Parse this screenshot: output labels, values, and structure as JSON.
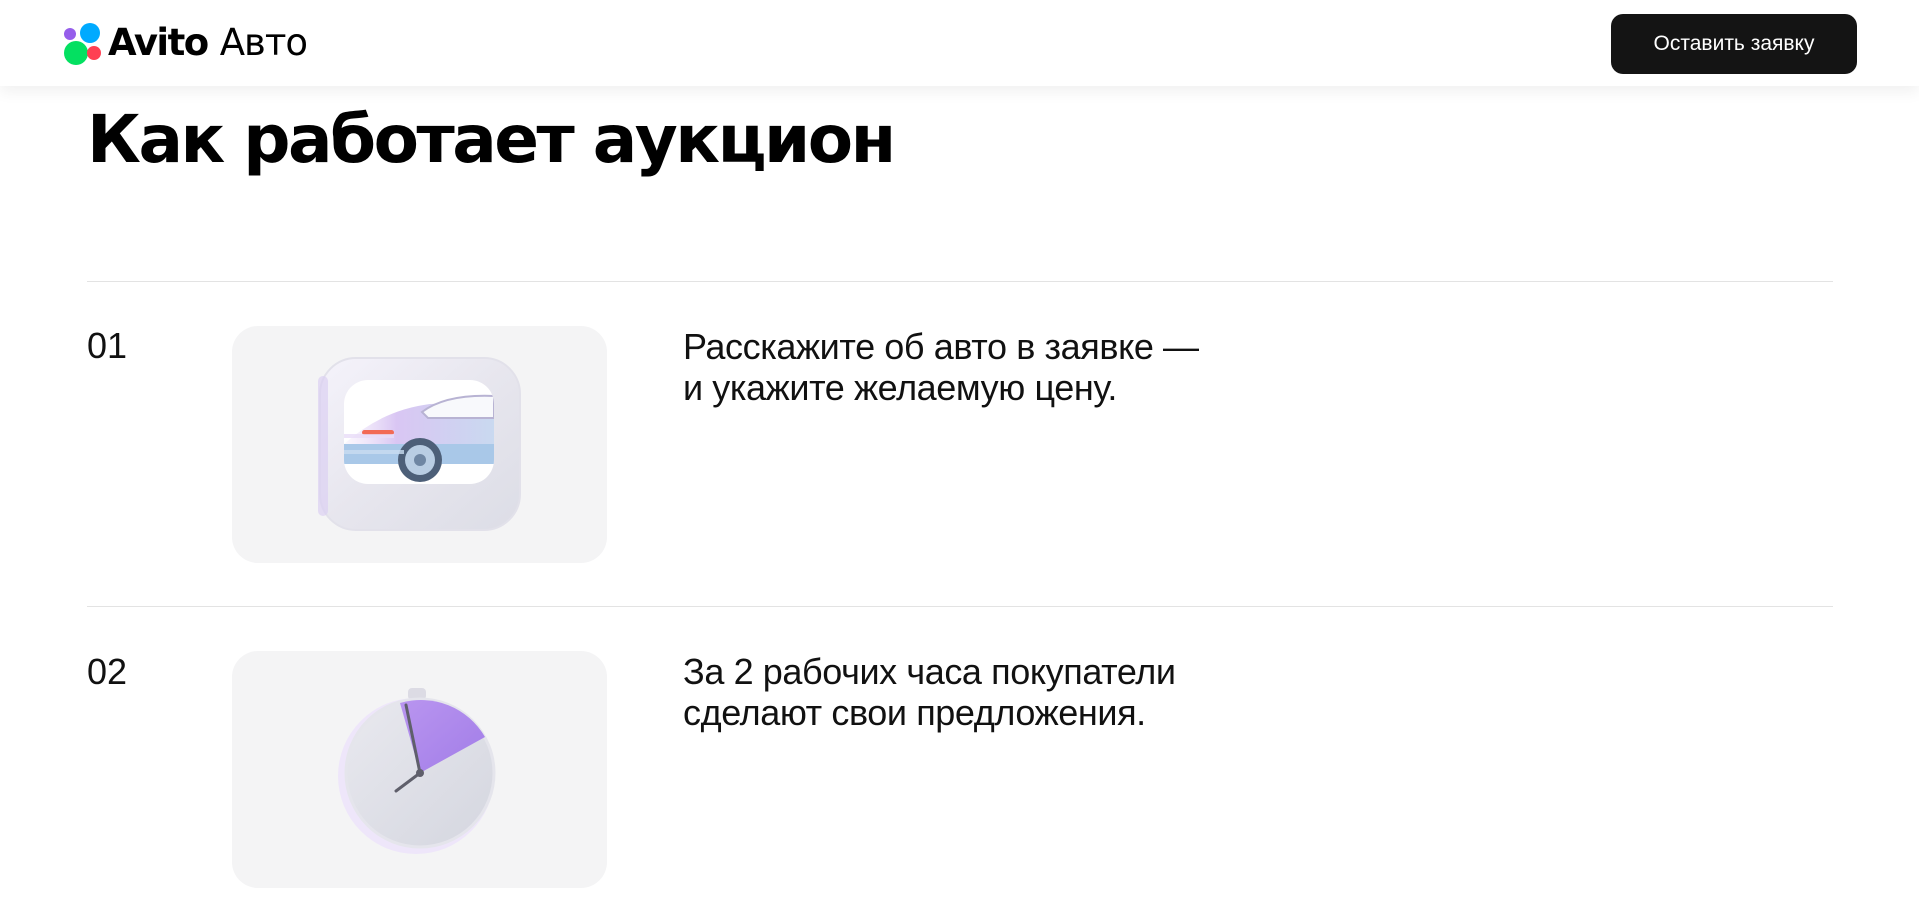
{
  "header": {
    "brand": "Avito",
    "brand_suffix": "Авто",
    "cta_label": "Оставить заявку"
  },
  "page_title": "Как работает аукцион",
  "steps": [
    {
      "number": "01",
      "lines": [
        "Расскажите об авто в заявке —",
        "и укажите желаемую цену."
      ],
      "illustration": "car-in-frame-icon"
    },
    {
      "number": "02",
      "lines": [
        "За 2 рабочих часа покупатели",
        "сделают свои предложения."
      ],
      "illustration": "stopwatch-icon"
    }
  ],
  "colors": {
    "accent_dark": "#141414",
    "card_bg": "#f4f4f5",
    "logo_purple": "#965eeb",
    "logo_blue": "#00aaff",
    "logo_green": "#04e061",
    "logo_red": "#ff4053"
  }
}
